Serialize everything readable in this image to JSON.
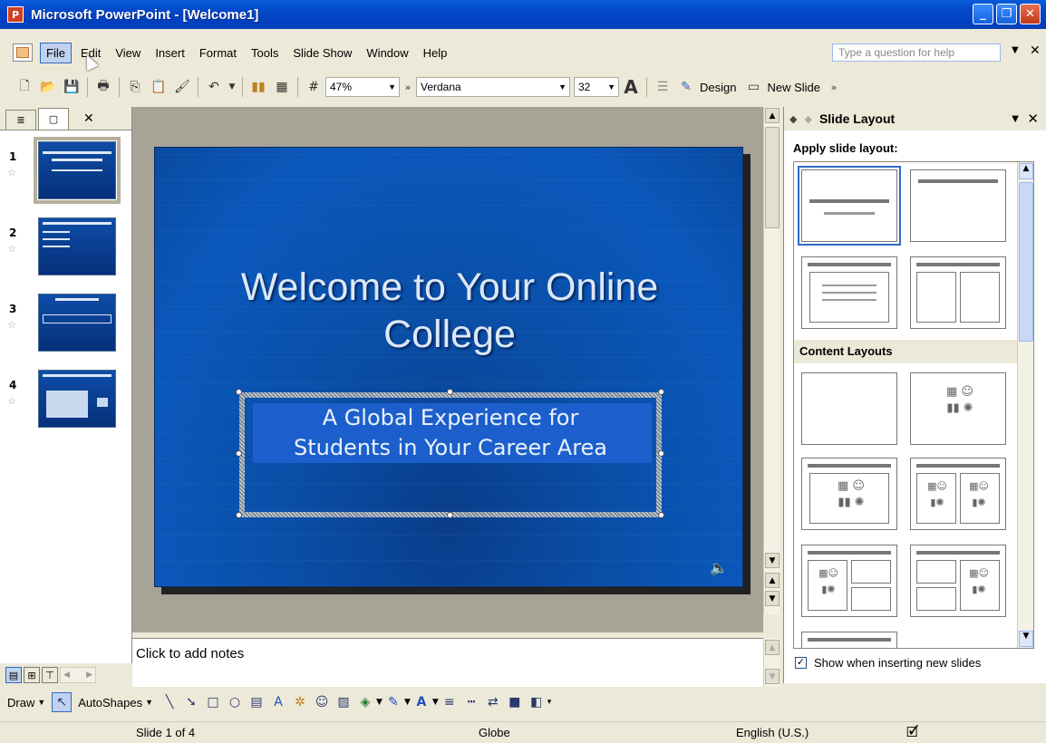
{
  "window": {
    "title": "Microsoft PowerPoint - [Welcome1]",
    "app_icon_glyph": "P",
    "minimize": "_",
    "restore": "❐",
    "close": "✕"
  },
  "menu": {
    "items": [
      "File",
      "Edit",
      "View",
      "Insert",
      "Format",
      "Tools",
      "Slide Show",
      "Window",
      "Help"
    ],
    "help_placeholder": "Type a question for help"
  },
  "toolbar": {
    "zoom": "47%",
    "font": "Verdana",
    "font_size": "32",
    "design_label": "Design",
    "new_slide_label": "New Slide"
  },
  "left_pane": {
    "slides": [
      {
        "number": "1"
      },
      {
        "number": "2"
      },
      {
        "number": "3"
      },
      {
        "number": "4"
      }
    ]
  },
  "slide": {
    "title": "Welcome to Your Online College",
    "title_line1": "Welcome to Your Online",
    "title_line2": "College",
    "subtitle_line1": "A Global Experience for",
    "subtitle_line2": "Students in Your Career Area"
  },
  "notes": {
    "placeholder": "Click to add notes"
  },
  "task_pane": {
    "title": "Slide Layout",
    "apply_label": "Apply slide layout:",
    "content_layouts_label": "Content Layouts",
    "show_checkbox_label": "Show when inserting new slides"
  },
  "drawing_toolbar": {
    "draw_label": "Draw",
    "autoshapes_label": "AutoShapes"
  },
  "status": {
    "slide_position": "Slide 1 of 4",
    "design_template": "Globe",
    "language": "English (U.S.)"
  },
  "colors": {
    "titlebar": "#0347C7",
    "slide_background": "#0B58BC",
    "slide_text": "#DCE8F6",
    "selection_blue": "#316AC5"
  }
}
